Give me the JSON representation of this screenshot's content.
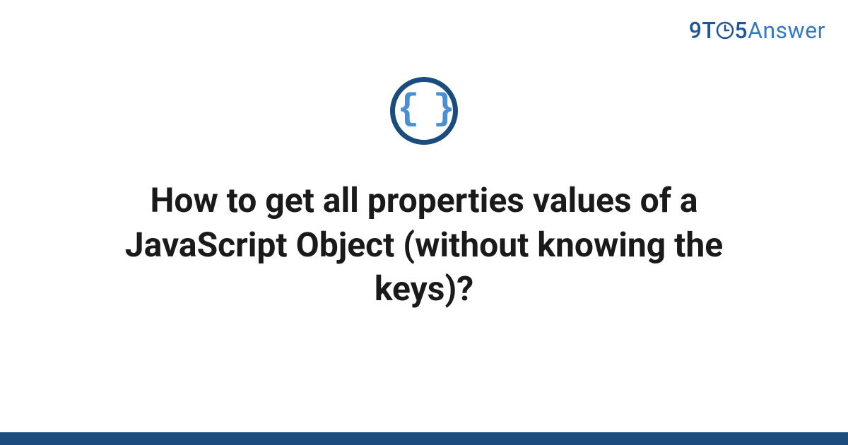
{
  "logo": {
    "part1": "9T",
    "part2": "5",
    "part3": "Answer"
  },
  "icon": {
    "name": "code-braces-icon",
    "glyph": "{ }"
  },
  "title": "How to get all properties values of a JavaScript Object (without knowing the keys)?",
  "colors": {
    "brand_dark": "#1a4d7d",
    "brand_light": "#3577c4",
    "accent": "#4a8fd4"
  }
}
